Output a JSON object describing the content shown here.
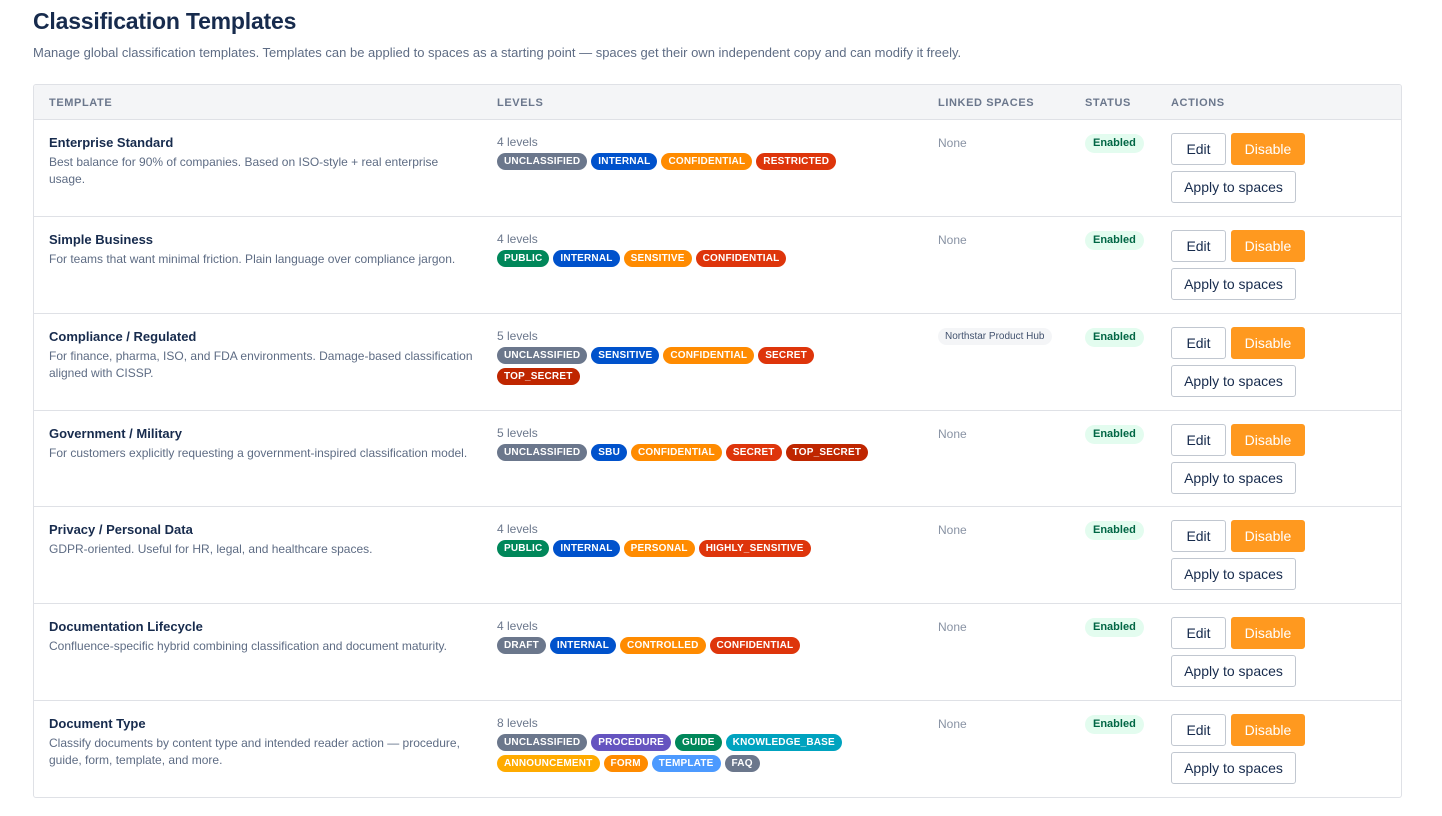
{
  "page": {
    "title": "Classification Templates",
    "subtitle": "Manage global classification templates. Templates can be applied to spaces as a starting point — spaces get their own independent copy and can modify it freely."
  },
  "table": {
    "headers": [
      "TEMPLATE",
      "LEVELS",
      "LINKED SPACES",
      "STATUS",
      "ACTIONS"
    ]
  },
  "colors": {
    "gray": "#6b778c",
    "blue": "#0052cc",
    "orange": "#ff8b00",
    "red": "#de350b",
    "darkred": "#bf2600",
    "green": "#00875a",
    "purple": "#6554c0",
    "teal": "#00a3bf",
    "amber": "#ffab00",
    "lightblue": "#4c9aff",
    "disable_button": "#ff991f",
    "status_bg": "#e3fcef",
    "status_text": "#006644"
  },
  "actions": {
    "edit": "Edit",
    "disable": "Disable",
    "apply": "Apply to spaces"
  },
  "templates": [
    {
      "name": "Enterprise Standard",
      "description": "Best balance for 90% of companies. Based on ISO-style + real enterprise usage.",
      "levels_text": "4 levels",
      "levels": [
        {
          "label": "UNCLASSIFIED",
          "color": "gray"
        },
        {
          "label": "INTERNAL",
          "color": "blue"
        },
        {
          "label": "CONFIDENTIAL",
          "color": "orange"
        },
        {
          "label": "RESTRICTED",
          "color": "red"
        }
      ],
      "linked": "None",
      "linked_is_pill": false,
      "status": "Enabled"
    },
    {
      "name": "Simple Business",
      "description": "For teams that want minimal friction. Plain language over compliance jargon.",
      "levels_text": "4 levels",
      "levels": [
        {
          "label": "PUBLIC",
          "color": "green"
        },
        {
          "label": "INTERNAL",
          "color": "blue"
        },
        {
          "label": "SENSITIVE",
          "color": "orange"
        },
        {
          "label": "CONFIDENTIAL",
          "color": "red"
        }
      ],
      "linked": "None",
      "linked_is_pill": false,
      "status": "Enabled"
    },
    {
      "name": "Compliance / Regulated",
      "description": "For finance, pharma, ISO, and FDA environments. Damage-based classification aligned with CISSP.",
      "levels_text": "5 levels",
      "levels": [
        {
          "label": "UNCLASSIFIED",
          "color": "gray"
        },
        {
          "label": "SENSITIVE",
          "color": "blue"
        },
        {
          "label": "CONFIDENTIAL",
          "color": "orange"
        },
        {
          "label": "SECRET",
          "color": "red"
        },
        {
          "label": "TOP_SECRET",
          "color": "darkred"
        }
      ],
      "linked": "Northstar Product Hub",
      "linked_is_pill": true,
      "status": "Enabled"
    },
    {
      "name": "Government / Military",
      "description": "For customers explicitly requesting a government-inspired classification model.",
      "levels_text": "5 levels",
      "levels": [
        {
          "label": "UNCLASSIFIED",
          "color": "gray"
        },
        {
          "label": "SBU",
          "color": "blue"
        },
        {
          "label": "CONFIDENTIAL",
          "color": "orange"
        },
        {
          "label": "SECRET",
          "color": "red"
        },
        {
          "label": "TOP_SECRET",
          "color": "darkred"
        }
      ],
      "linked": "None",
      "linked_is_pill": false,
      "status": "Enabled"
    },
    {
      "name": "Privacy / Personal Data",
      "description": "GDPR-oriented. Useful for HR, legal, and healthcare spaces.",
      "levels_text": "4 levels",
      "levels": [
        {
          "label": "PUBLIC",
          "color": "green"
        },
        {
          "label": "INTERNAL",
          "color": "blue"
        },
        {
          "label": "PERSONAL",
          "color": "orange"
        },
        {
          "label": "HIGHLY_SENSITIVE",
          "color": "red"
        }
      ],
      "linked": "None",
      "linked_is_pill": false,
      "status": "Enabled"
    },
    {
      "name": "Documentation Lifecycle",
      "description": "Confluence-specific hybrid combining classification and document maturity.",
      "levels_text": "4 levels",
      "levels": [
        {
          "label": "DRAFT",
          "color": "gray"
        },
        {
          "label": "INTERNAL",
          "color": "blue"
        },
        {
          "label": "CONTROLLED",
          "color": "orange"
        },
        {
          "label": "CONFIDENTIAL",
          "color": "red"
        }
      ],
      "linked": "None",
      "linked_is_pill": false,
      "status": "Enabled"
    },
    {
      "name": "Document Type",
      "description": "Classify documents by content type and intended reader action — procedure, guide, form, template, and more.",
      "levels_text": "8 levels",
      "levels": [
        {
          "label": "UNCLASSIFIED",
          "color": "gray"
        },
        {
          "label": "PROCEDURE",
          "color": "purple"
        },
        {
          "label": "GUIDE",
          "color": "green"
        },
        {
          "label": "KNOWLEDGE_BASE",
          "color": "teal"
        },
        {
          "label": "ANNOUNCEMENT",
          "color": "amber"
        },
        {
          "label": "FORM",
          "color": "orange"
        },
        {
          "label": "TEMPLATE",
          "color": "lightblue"
        },
        {
          "label": "FAQ",
          "color": "gray"
        }
      ],
      "linked": "None",
      "linked_is_pill": false,
      "status": "Enabled"
    }
  ]
}
